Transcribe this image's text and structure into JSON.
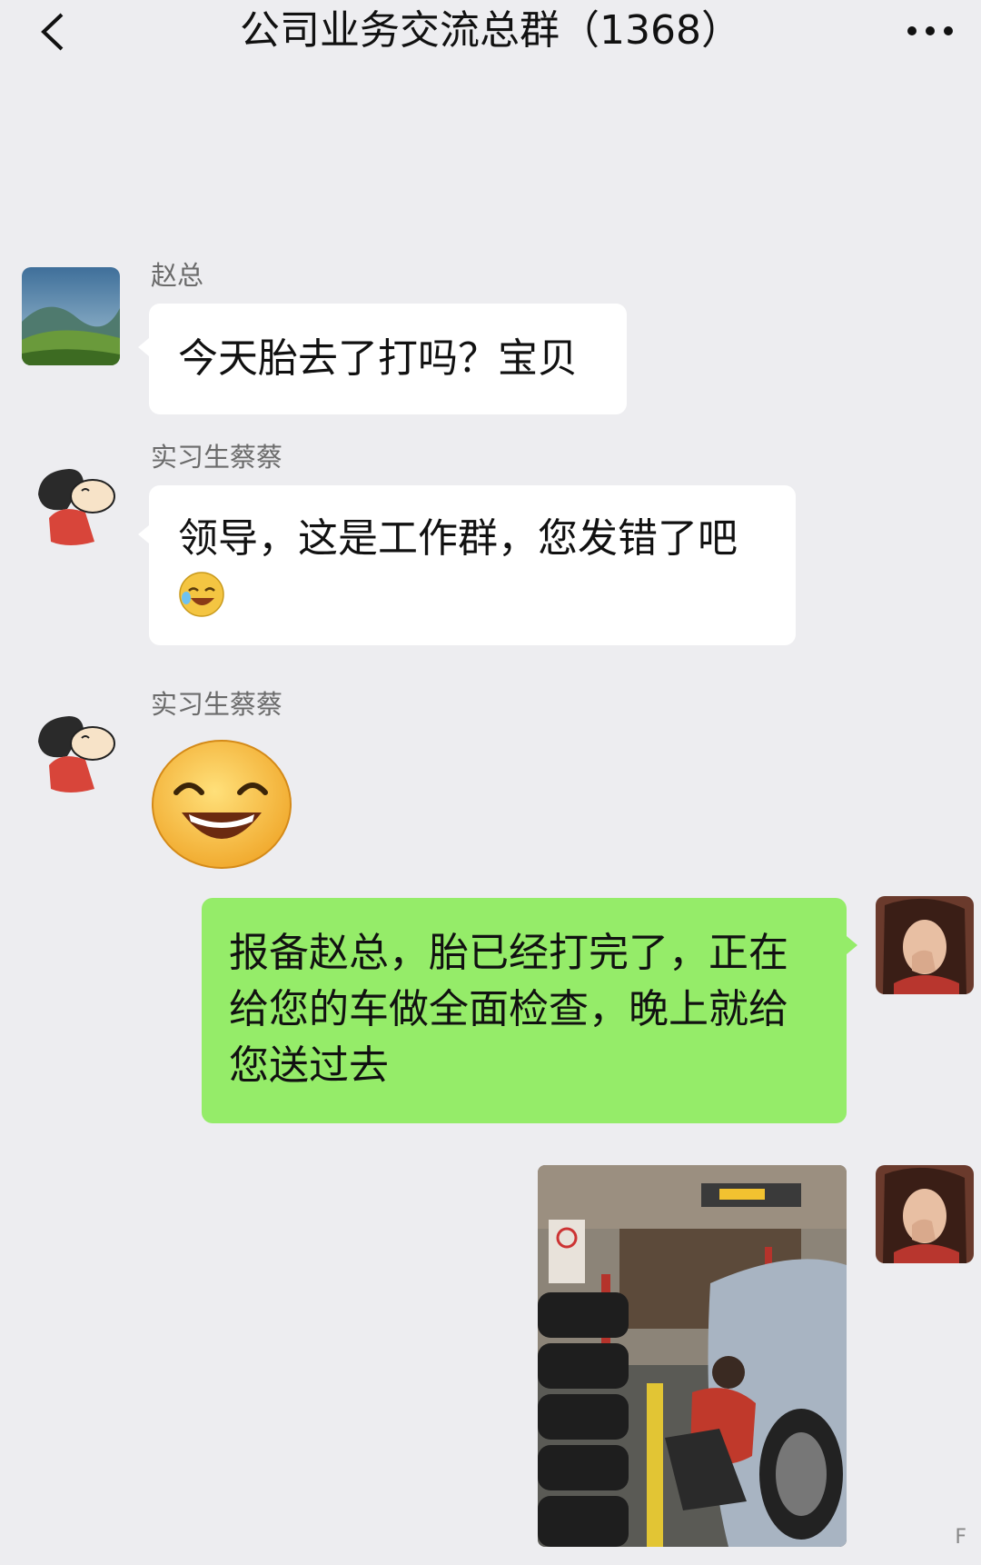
{
  "header": {
    "title": "公司业务交流总群（1368）",
    "back_icon": "chevron-left-icon",
    "more_icon": "ellipsis-icon"
  },
  "messages": [
    {
      "sender": "赵总",
      "text": "今天胎去了打吗？宝贝",
      "side": "left",
      "avatar": "landscape-avatar"
    },
    {
      "sender": "实习生蔡蔡",
      "text": "领导，这是工作群，您发错了吧",
      "emoji": "laughing-crying-emoji",
      "side": "left",
      "avatar": "cartoon-avatar"
    },
    {
      "sender": "实习生蔡蔡",
      "sticker": "big-grin-emoji",
      "side": "left",
      "avatar": "cartoon-avatar"
    },
    {
      "text": "报备赵总，胎已经打完了，正在给您的车做全面检查，晚上就给您送过去",
      "side": "right",
      "avatar": "woman-avatar"
    },
    {
      "image": "tire-shop-photo",
      "side": "right",
      "avatar": "woman-avatar"
    }
  ],
  "colors": {
    "background": "#ededf0",
    "bubble_left": "#ffffff",
    "bubble_right": "#95ec69",
    "sender_text": "#6b6b6b"
  },
  "watermark": "F"
}
